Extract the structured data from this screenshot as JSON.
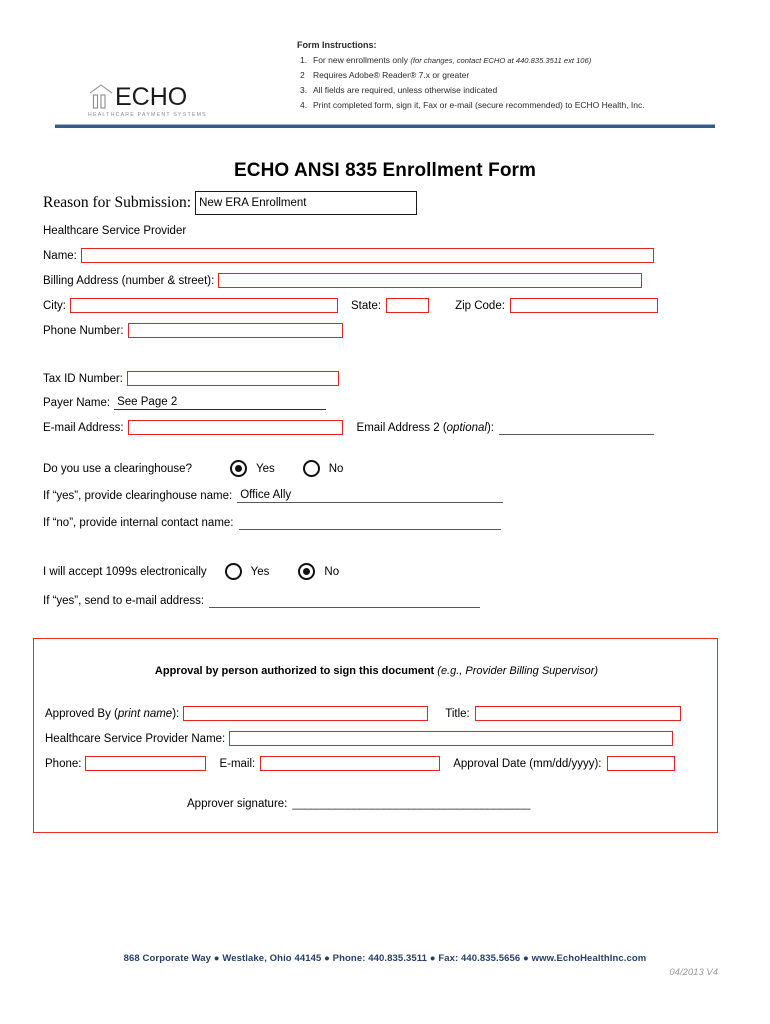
{
  "header": {
    "logo": {
      "word": "ECHO",
      "tagline": "HEALTHCARE PAYMENT SYSTEMS"
    },
    "instructions": {
      "title": "Form Instructions:",
      "items": [
        {
          "num": "1.",
          "text": "For new enrollments only ",
          "italic": "(for changes, contact ECHO at 440.835.3511 ext 106)"
        },
        {
          "num": "2",
          "text": "Requires Adobe® Reader® 7.x or greater",
          "italic": ""
        },
        {
          "num": "3.",
          "text": "All fields are required, unless otherwise indicated",
          "italic": ""
        },
        {
          "num": "4.",
          "text": "Print completed form, sign it, Fax or e-mail (secure recommended) to ECHO Health, Inc.",
          "italic": ""
        }
      ]
    }
  },
  "title": "ECHO ANSI 835 Enrollment Form",
  "reason": {
    "label": "Reason for Submission:",
    "value": "New ERA Enrollment"
  },
  "provider_section": {
    "heading": "Healthcare Service Provider",
    "name_label": "Name:",
    "name_value": "",
    "billing_label": "Billing Address (number & street):",
    "billing_value": "",
    "city_label": "City:",
    "city_value": "",
    "state_label": "State:",
    "state_value": "",
    "zip_label": "Zip Code:",
    "zip_value": "",
    "phone_label": "Phone Number:",
    "phone_value": ""
  },
  "tax_section": {
    "tax_label": "Tax ID Number:",
    "tax_value": "",
    "payer_label": "Payer Name:",
    "payer_value": "See Page 2",
    "email_label": "E-mail Address:",
    "email_value": "",
    "email2_label_pre": "Email Address 2 (",
    "email2_label_ital": "optional",
    "email2_label_post": "):",
    "email2_value": ""
  },
  "clearinghouse": {
    "question": "Do you use a clearinghouse?",
    "yes_label": "Yes",
    "no_label": "No",
    "selected": "Yes",
    "yes_prompt": "If “yes”, provide clearinghouse name:",
    "yes_value": "Office Ally",
    "no_prompt": "If “no”, provide internal contact name:",
    "no_value": ""
  },
  "electronic_1099": {
    "question": "I will accept 1099s electronically",
    "yes_label": "Yes",
    "no_label": "No",
    "selected": "No",
    "email_prompt": "If “yes”, send to e-mail address:",
    "email_value": ""
  },
  "approval": {
    "title_bold": "Approval by person authorized to sign this document ",
    "title_italic": "(e.g., Provider Billing Supervisor)",
    "approved_by_pre": "Approved By (",
    "approved_by_ital": "print name",
    "approved_by_post": "):",
    "approved_by_value": "",
    "title_label": "Title:",
    "title_value": "",
    "provider_name_label": "Healthcare Service Provider Name:",
    "provider_name_value": "",
    "phone_label": "Phone:",
    "phone_value": "",
    "email_label": "E-mail:",
    "email_value": "",
    "date_label": "Approval Date (mm/dd/yyyy):",
    "date_value": "",
    "signature_label": "Approver signature:",
    "signature_line": "_______________________________________"
  },
  "footer": {
    "address": "868 Corporate Way  ●  Westlake, Ohio 44145  ●  Phone: 440.835.3511  ●  Fax: 440.835.5656  ●  www.EchoHealthInc.com",
    "version": "04/2013 V4"
  },
  "colors": {
    "required_border": "#e8221f",
    "header_rule": "#35598a",
    "footer_text": "#26406b"
  }
}
